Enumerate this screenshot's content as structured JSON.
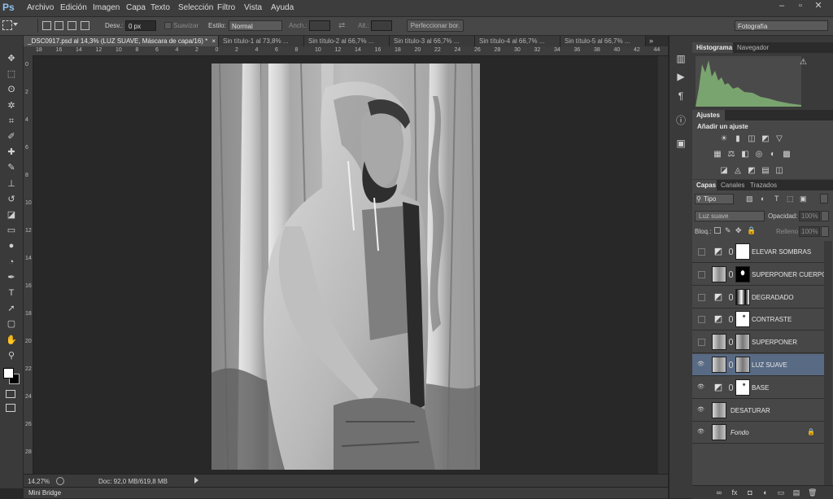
{
  "app": {
    "logo": "Ps"
  },
  "menu": [
    "Archivo",
    "Edición",
    "Imagen",
    "Capa",
    "Texto",
    "Selección",
    "Filtro",
    "Vista",
    "Ayuda"
  ],
  "window_controls": {
    "minimize": "–",
    "restore": "▫",
    "close": "✕"
  },
  "options": {
    "feather_label": "Desv.:",
    "feather_value": "0 px",
    "smooth_label": "Suavizar",
    "style_label": "Estilo:",
    "style_value": "Normal",
    "width_label": "Anch.:",
    "height_label": "Alt.:",
    "refine_button": "Perfeccionar bor.",
    "workspace": "Fotografía"
  },
  "tools": [
    {
      "icon": "move-tool-icon",
      "glyph": "✥"
    },
    {
      "icon": "marquee-tool-icon",
      "glyph": "⬚"
    },
    {
      "icon": "lasso-tool-icon",
      "glyph": "ʘ"
    },
    {
      "icon": "magic-wand-icon",
      "glyph": "✲"
    },
    {
      "icon": "crop-tool-icon",
      "glyph": "⌗"
    },
    {
      "icon": "eyedropper-icon",
      "glyph": "✐"
    },
    {
      "icon": "healing-brush-icon",
      "glyph": "✚"
    },
    {
      "icon": "brush-tool-icon",
      "glyph": "✎"
    },
    {
      "icon": "clone-stamp-icon",
      "glyph": "⊥"
    },
    {
      "icon": "history-brush-icon",
      "glyph": "↺"
    },
    {
      "icon": "eraser-tool-icon",
      "glyph": "◪"
    },
    {
      "icon": "gradient-tool-icon",
      "glyph": "▭"
    },
    {
      "icon": "blur-tool-icon",
      "glyph": "●"
    },
    {
      "icon": "dodge-tool-icon",
      "glyph": "◔"
    },
    {
      "icon": "pen-tool-icon",
      "glyph": "✒"
    },
    {
      "icon": "type-tool-icon",
      "glyph": "T"
    },
    {
      "icon": "path-selection-icon",
      "glyph": "➚"
    },
    {
      "icon": "shape-tool-icon",
      "glyph": "▢"
    },
    {
      "icon": "hand-tool-icon",
      "glyph": "✋"
    },
    {
      "icon": "zoom-tool-icon",
      "glyph": "⚲"
    }
  ],
  "tabs": [
    "_DSC0917.psd al 14,3% (LUZ SUAVE, Máscara de capa/16) *",
    "Sin título-1 al 73,8% ...",
    "Sin título-2 al 66,7% ...",
    "Sin título-3 al 66,7% ...",
    "Sin título-4 al 66,7% ...",
    "Sin título-5 al 66,7% ..."
  ],
  "tab_close": "×",
  "ruler": {
    "h_ticks": [
      "18",
      "16",
      "14",
      "12",
      "10",
      "8",
      "6",
      "4",
      "2",
      "0",
      "2",
      "4",
      "6",
      "8",
      "10",
      "12",
      "14",
      "16",
      "18",
      "20",
      "22",
      "24",
      "26",
      "28",
      "30",
      "32",
      "34",
      "36",
      "38",
      "40",
      "42",
      "44"
    ],
    "v_ticks": [
      "0",
      "2",
      "4",
      "6",
      "8",
      "10",
      "12",
      "14",
      "16",
      "18",
      "20",
      "22",
      "24",
      "26",
      "28"
    ]
  },
  "status": {
    "zoom": "14,27%",
    "doc": "Doc: 92,0 MB/619,8 MB"
  },
  "mini_bridge": "Mini Bridge",
  "histogram": {
    "tabs": [
      "Histograma",
      "Navegador"
    ],
    "warning": "⚠"
  },
  "ajustes": {
    "tab": "Ajustes",
    "title": "Añadir un ajuste",
    "icons_row1": [
      "☀",
      "▮",
      "◫",
      "◩",
      "▽"
    ],
    "icons_row2": [
      "▦",
      "⚖",
      "◧",
      "◎",
      "◐",
      "▩"
    ],
    "icons_row3": [
      "◪",
      "◬",
      "◩",
      "▤",
      "◫"
    ]
  },
  "layers_panel": {
    "tabs": [
      "Capas",
      "Canales",
      "Trazados"
    ],
    "filter_label": "Tipo",
    "blend_mode": "Luz suave",
    "opacity_label": "Opacidad:",
    "opacity_value": "100%",
    "lock_label": "Bloq.:",
    "fill_label": "Relleno:",
    "fill_value": "100%",
    "layers": [
      {
        "name": "ELEVAR SOMBRAS",
        "visible": false,
        "kind": "adjustment",
        "mask": "white",
        "selected": false
      },
      {
        "name": "SUPERPONER CUERPO",
        "visible": false,
        "kind": "photo",
        "mask": "black-figure",
        "selected": false
      },
      {
        "name": "DEGRADADO",
        "visible": false,
        "kind": "adjustment",
        "mask": "gradient",
        "selected": false
      },
      {
        "name": "CONTRASTE",
        "visible": false,
        "kind": "adjustment",
        "mask": "white-mark",
        "selected": false
      },
      {
        "name": "SUPERPONER",
        "visible": false,
        "kind": "photo",
        "mask": "photo",
        "selected": false
      },
      {
        "name": "LUZ SUAVE",
        "visible": true,
        "kind": "photo",
        "mask": "photo",
        "selected": true
      },
      {
        "name": "BASE",
        "visible": true,
        "kind": "adjustment",
        "mask": "white-mark",
        "selected": false
      },
      {
        "name": "DESATURAR",
        "visible": true,
        "kind": "photo",
        "mask": "none",
        "selected": false
      },
      {
        "name": "Fondo",
        "visible": true,
        "kind": "photo",
        "mask": "none",
        "selected": false,
        "locked": true
      }
    ],
    "footer_icons": [
      "∞",
      "fx",
      "◘",
      "◐",
      "▭",
      "▤",
      "🗑"
    ]
  },
  "colors": {
    "selected_layer": "#586a84",
    "accent_logo": "#8fc2ef"
  }
}
